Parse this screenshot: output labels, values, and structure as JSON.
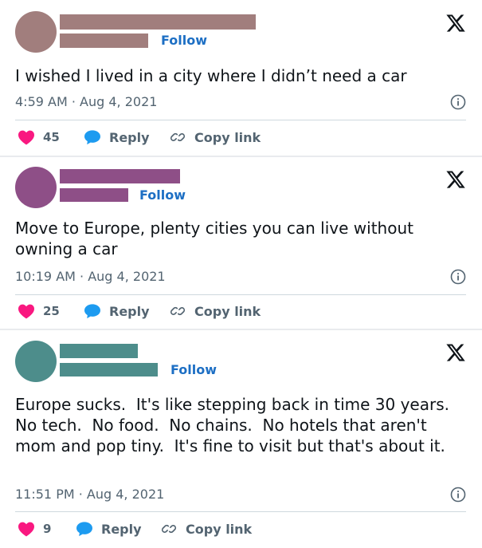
{
  "colors": {
    "follow": "#1d6fc4",
    "heart": "#f91880",
    "reply_bubble": "#1d9bf0",
    "secondary_text": "#536471"
  },
  "tweets": [
    {
      "avatar_color": "#a17e7d",
      "name_bar_color": "#a17e7d",
      "follow_label": "Follow",
      "text": "I wished I lived in a city where I didn’t need a car",
      "timestamp": "4:59 AM · Aug 4, 2021",
      "likes": "45",
      "reply_label": "Reply",
      "copy_label": "Copy link"
    },
    {
      "avatar_color": "#8e4f87",
      "name_bar_color": "#8e4f87",
      "follow_label": "Follow",
      "text": "Move to Europe, plenty cities you can live without owning a car",
      "timestamp": "10:19 AM · Aug 4, 2021",
      "likes": "25",
      "reply_label": "Reply",
      "copy_label": "Copy link"
    },
    {
      "avatar_color": "#4d8d8b",
      "name_bar_color": "#4d8d8b",
      "follow_label": "Follow",
      "text": "Europe sucks.  It's like stepping back in time 30 years.  No tech.  No food.  No chains.  No hotels that aren't mom and pop tiny.  It's fine to visit but that's about it.",
      "timestamp": "11:51 PM · Aug 4, 2021",
      "likes": "9",
      "reply_label": "Reply",
      "copy_label": "Copy link"
    }
  ]
}
